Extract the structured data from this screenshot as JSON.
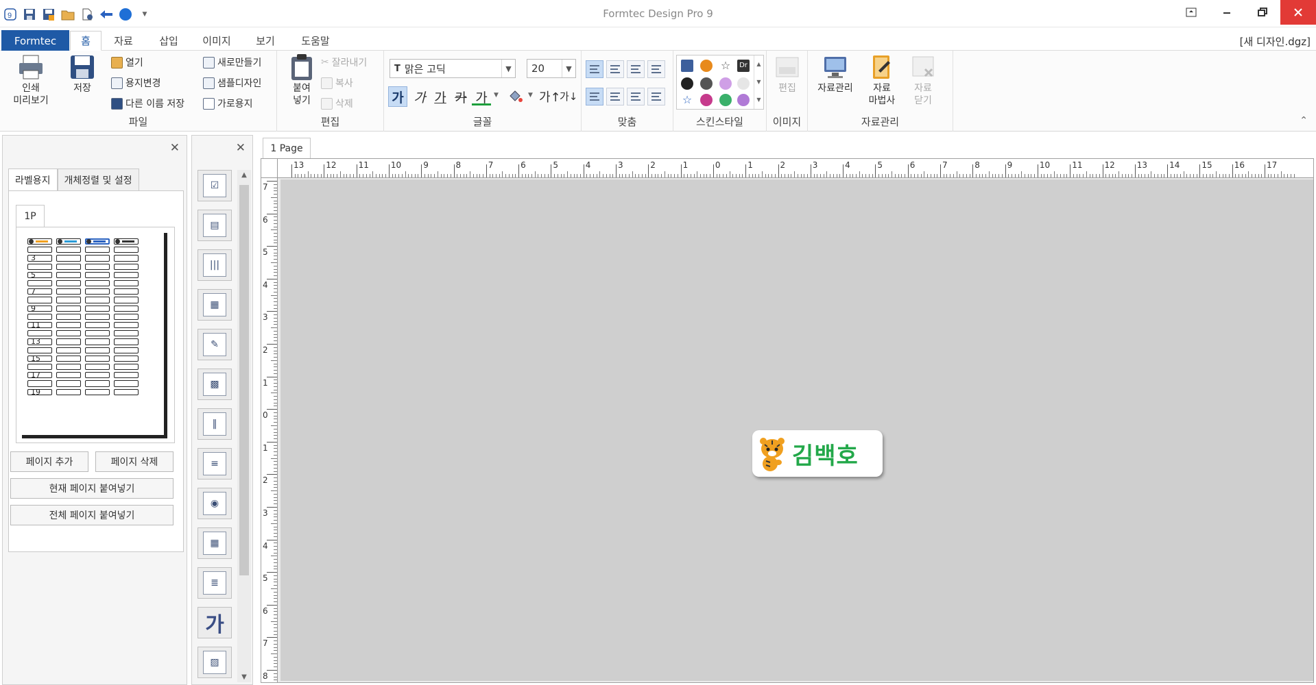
{
  "window": {
    "title": "Formtec Design Pro 9",
    "document": "[새 디자인.dgz]",
    "controls": [
      "restore-ribbon",
      "minimize",
      "maximize",
      "close"
    ]
  },
  "quick_access": [
    "app-logo",
    "save",
    "save-as",
    "open",
    "new",
    "undo",
    "theme"
  ],
  "menu": {
    "file_tab": "Formtec",
    "tabs": [
      "홈",
      "자료",
      "삽입",
      "이미지",
      "보기",
      "도움말"
    ],
    "active": "홈"
  },
  "ribbon": {
    "file_group": {
      "label": "파일",
      "preview": "인쇄\n미리보기",
      "save": "저장",
      "open": "열기",
      "change_paper": "용지변경",
      "save_as": "다른 이름 저장",
      "new": "새로만들기",
      "sample": "샘플디자인",
      "landscape": "가로용지"
    },
    "edit_group": {
      "label": "편집",
      "paste": "붙여\n넣기",
      "cut": "잘라내기",
      "copy": "복사",
      "delete": "삭제"
    },
    "font_group": {
      "label": "글꼴",
      "font_name": "맑은 고딕",
      "font_size": "20",
      "styles": [
        "가",
        "가",
        "가",
        "카",
        "가"
      ]
    },
    "align_group": {
      "label": "맞춤"
    },
    "skin_group": {
      "label": "스킨스타일",
      "dr": "Dr"
    },
    "image_group": {
      "label": "이미지",
      "edit": "편집"
    },
    "data_group": {
      "label": "자료관리",
      "manage": "자료관리",
      "wizard": "자료\n마법사",
      "close": "자료\n닫기"
    }
  },
  "left_panel": {
    "tabs": [
      "라벨용지",
      "개체정렬 및 설정"
    ],
    "active_tab": "라벨용지",
    "subtab": "1P",
    "row_numbers": [
      "3",
      "5",
      "7",
      "9",
      "11",
      "13",
      "15",
      "17",
      "19"
    ],
    "buttons": {
      "add_page": "페이지 추가",
      "delete_page": "페이지 삭제",
      "paste_current": "현재 페이지 붙여넣기",
      "paste_all": "전체 페이지 붙여넣기"
    }
  },
  "tools": [
    "checklist",
    "text-box",
    "barcode-text",
    "multi-text",
    "text-effect",
    "qr-code",
    "barcode",
    "color-barcode",
    "image-badge",
    "table",
    "list",
    "big-text",
    "picture"
  ],
  "tool_big_text": "가",
  "document": {
    "page_tab": "1 Page",
    "label_text": "김백호",
    "h_ruler": [
      "13",
      "12",
      "11",
      "10",
      "9",
      "8",
      "7",
      "6",
      "5",
      "4",
      "3",
      "2",
      "1",
      "0",
      "1",
      "2",
      "3",
      "4",
      "5",
      "6",
      "7",
      "8",
      "9",
      "10",
      "11",
      "12",
      "13",
      "14",
      "15",
      "16",
      "17"
    ],
    "v_ruler": [
      "7",
      "6",
      "5",
      "4",
      "3",
      "2",
      "1",
      "0",
      "1",
      "2",
      "3",
      "4",
      "5",
      "6",
      "7",
      "8"
    ]
  }
}
